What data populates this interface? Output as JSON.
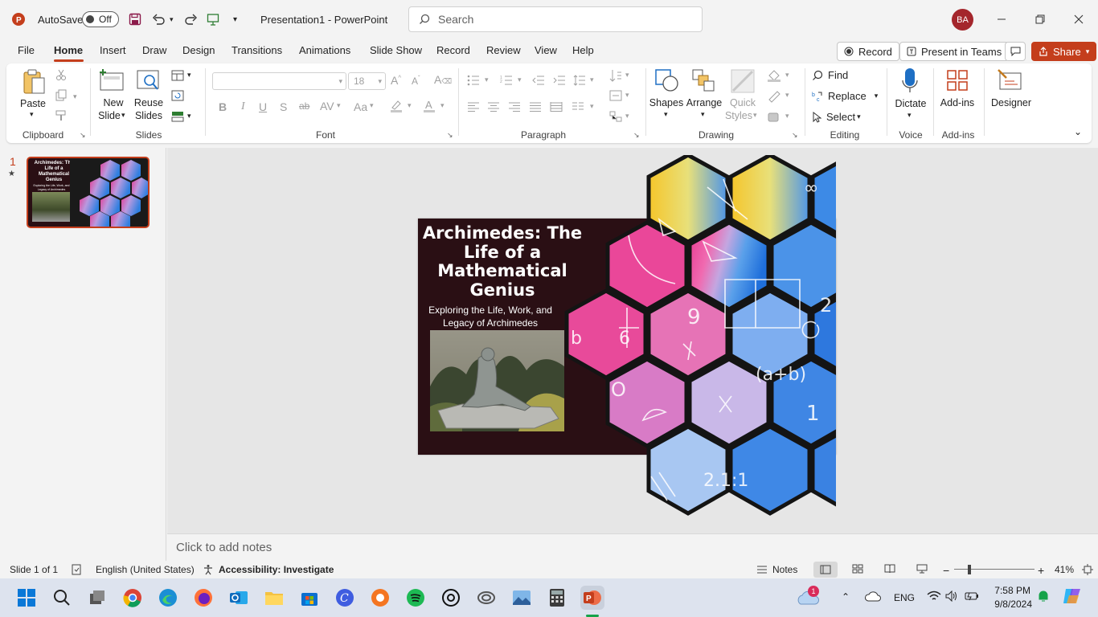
{
  "titlebar": {
    "autosave_label": "AutoSave",
    "autosave_state": "Off",
    "document_title": "Presentation1  -  PowerPoint",
    "search_placeholder": "Search",
    "avatar_initials": "BA"
  },
  "tabs": [
    "File",
    "Home",
    "Insert",
    "Draw",
    "Design",
    "Transitions",
    "Animations",
    "Slide Show",
    "Record",
    "Review",
    "View",
    "Help"
  ],
  "active_tab": "Home",
  "ribbon_right": {
    "record": "Record",
    "present_in_teams": "Present in Teams",
    "share": "Share"
  },
  "ribbon": {
    "clipboard": {
      "label": "Clipboard",
      "paste": "Paste"
    },
    "slides": {
      "label": "Slides",
      "new_slide_1": "New",
      "new_slide_2": "Slide",
      "reuse_1": "Reuse",
      "reuse_2": "Slides"
    },
    "font": {
      "label": "Font",
      "font_size": "18"
    },
    "paragraph": {
      "label": "Paragraph"
    },
    "drawing": {
      "label": "Drawing",
      "shapes": "Shapes",
      "arrange": "Arrange",
      "quick_styles_1": "Quick",
      "quick_styles_2": "Styles"
    },
    "editing": {
      "label": "Editing",
      "find": "Find",
      "replace": "Replace",
      "select": "Select"
    },
    "voice": {
      "label": "Voice",
      "dictate": "Dictate"
    },
    "addins": {
      "label": "Add-ins",
      "addins": "Add-ins"
    },
    "designer": {
      "designer": "Designer"
    }
  },
  "thumbnail": {
    "number": "1",
    "title": "Archimedes: The Life of a Mathematical Genius",
    "subtitle": "Exploring the Life, Work, and Legacy of Archimedes"
  },
  "slide": {
    "title": "Archimedes: The Life of a Mathematical Genius",
    "subtitle": "Exploring the Life, Work, and Legacy of Archimedes"
  },
  "notes_placeholder": "Click to add notes",
  "statusbar": {
    "slide_count": "Slide 1 of 1",
    "language": "English (United States)",
    "accessibility": "Accessibility: Investigate",
    "notes": "Notes",
    "zoom": "41%"
  },
  "taskbar": {
    "badge_count": "1",
    "language": "ENG",
    "time": "7:58 PM",
    "date": "9/8/2024"
  },
  "colors": {
    "accent": "#c43e1c",
    "slide_bg": "#2a0f14",
    "taskbar_bg": "#dde3ee"
  }
}
